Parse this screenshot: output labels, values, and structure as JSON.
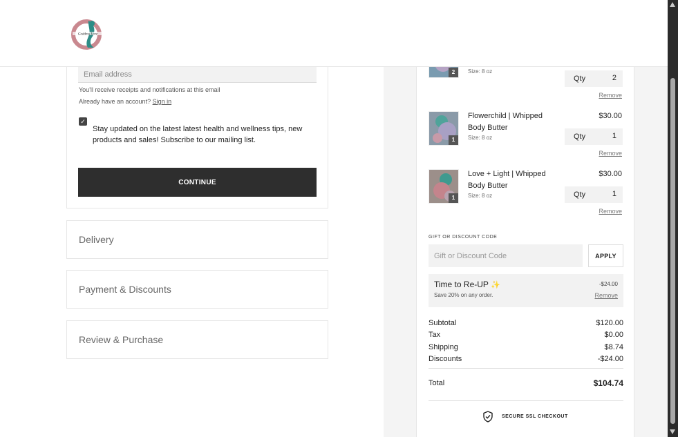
{
  "contact": {
    "email_placeholder": "Email address",
    "receipt_note": "You'll receive receipts and notifications at this email",
    "account_prompt": "Already have an account?",
    "sign_in_label": "Sign in",
    "newsletter_checked": true,
    "newsletter_label": "Stay updated on the latest latest health and wellness tips, new products and sales! Subscribe to our mailing list.",
    "continue_label": "CONTINUE"
  },
  "steps": [
    {
      "label": "Delivery"
    },
    {
      "label": "Payment & Discounts"
    },
    {
      "label": "Review & Purchase"
    }
  ],
  "cart": {
    "items": [
      {
        "name": "",
        "size": "Size: 8 oz",
        "price": "",
        "qty_label": "Qty",
        "qty": "2",
        "remove_label": "Remove",
        "badge": "2"
      },
      {
        "name": "Flowerchild | Whipped Body Butter",
        "size": "Size: 8 oz",
        "price": "$30.00",
        "qty_label": "Qty",
        "qty": "1",
        "remove_label": "Remove",
        "badge": "1"
      },
      {
        "name": "Love + Light | Whipped Body Butter",
        "size": "Size: 8 oz",
        "price": "$30.00",
        "qty_label": "Qty",
        "qty": "1",
        "remove_label": "Remove",
        "badge": "1"
      }
    ],
    "discount_code_label": "GIFT OR DISCOUNT CODE",
    "discount_code_placeholder": "Gift or Discount Code",
    "apply_label": "APPLY",
    "promo": {
      "title": "Time to Re-UP",
      "sparkle_icon": "sparkles-icon",
      "description": "Save 20% on any order.",
      "amount": "-$24.00",
      "remove_label": "Remove"
    },
    "totals": {
      "subtotal_label": "Subtotal",
      "subtotal": "$120.00",
      "tax_label": "Tax",
      "tax": "$0.00",
      "shipping_label": "Shipping",
      "shipping": "$8.74",
      "discounts_label": "Discounts",
      "discounts": "-$24.00",
      "total_label": "Total",
      "total": "$104.74"
    },
    "secure_label": "SECURE SSL CHECKOUT"
  }
}
